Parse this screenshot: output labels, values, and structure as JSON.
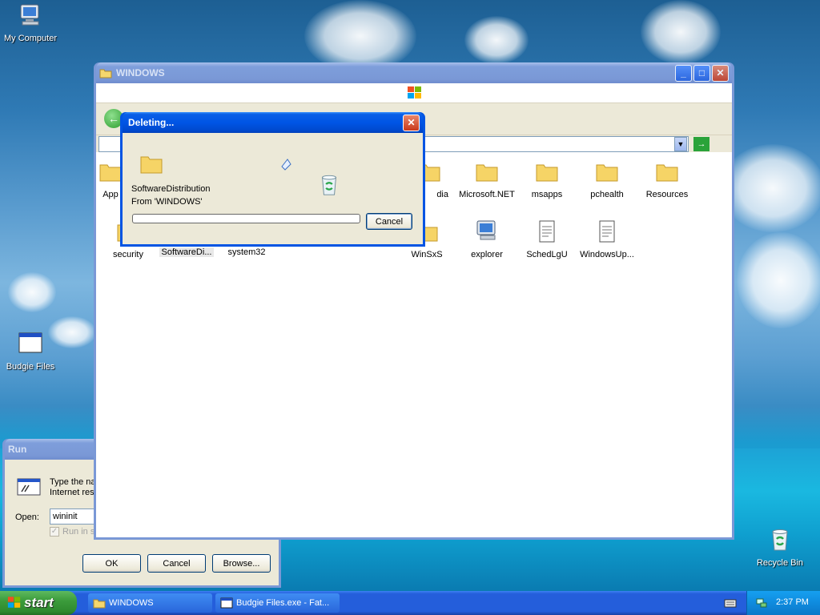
{
  "desktop": {
    "icons": [
      {
        "label": "My Computer"
      },
      {
        "label": "Budgie Files"
      },
      {
        "label": "Recycle Bin"
      }
    ]
  },
  "explorer": {
    "title": "WINDOWS",
    "items_row1": [
      "Microsoft.NET",
      "msapps",
      "pchealth",
      "Resources"
    ],
    "items_row2": [
      "security",
      "SoftwareDi...",
      "system32",
      "WinSxS",
      "explorer",
      "SchedLgU",
      "WindowsUp..."
    ],
    "partial_labels": [
      "App",
      "dia"
    ]
  },
  "deleting": {
    "title": "Deleting...",
    "file_name": "SoftwareDistribution",
    "from_text": "From 'WINDOWS'",
    "cancel_label": "Cancel",
    "progress": 0.0
  },
  "run": {
    "title": "Run",
    "desc_line1": "Type the na",
    "desc_line2": "Internet res",
    "open_label": "Open:",
    "open_value": "wininit",
    "checkbox_label": "Run in se",
    "ok_label": "OK",
    "cancel_label": "Cancel",
    "browse_label": "Browse..."
  },
  "taskbar": {
    "start_label": "start",
    "tasks": [
      {
        "label": "WINDOWS"
      },
      {
        "label": "Budgie Files.exe - Fat..."
      }
    ],
    "clock": "2:37 PM"
  },
  "colors": {
    "title_blue": "#0054e3",
    "start_green": "#3c9c3c",
    "dialog_bg": "#ece9d8"
  }
}
